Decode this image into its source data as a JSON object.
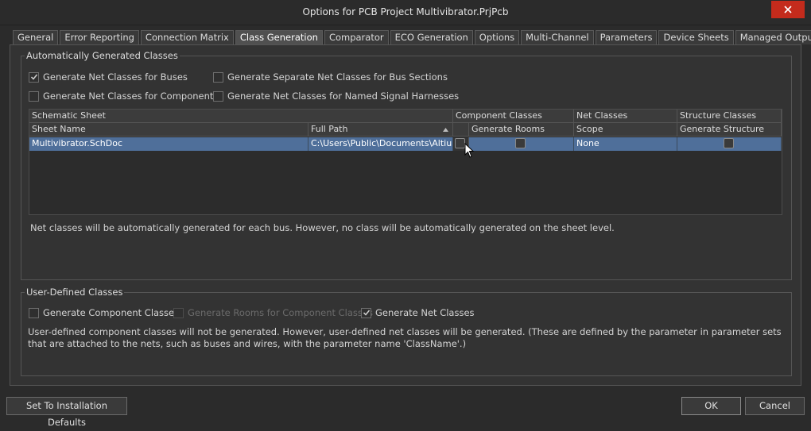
{
  "window": {
    "title": "Options for PCB Project Multivibrator.PrjPcb"
  },
  "tabs": [
    {
      "label": "General"
    },
    {
      "label": "Error Reporting"
    },
    {
      "label": "Connection Matrix"
    },
    {
      "label": "Class Generation",
      "active": true
    },
    {
      "label": "Comparator"
    },
    {
      "label": "ECO Generation"
    },
    {
      "label": "Options"
    },
    {
      "label": "Multi-Channel"
    },
    {
      "label": "Parameters"
    },
    {
      "label": "Device Sheets"
    },
    {
      "label": "Managed OutputJobs"
    }
  ],
  "auto": {
    "title": "Automatically Generated Classes",
    "buses_label": "Generate Net Classes for Buses",
    "buses_checked": true,
    "components_label": "Generate Net Classes for Components",
    "components_checked": false,
    "bus_sections_label": "Generate Separate Net Classes for Bus Sections",
    "bus_sections_checked": false,
    "harnesses_label": "Generate Net Classes for Named Signal Harnesses",
    "harnesses_checked": false,
    "grid": {
      "group_headers": {
        "schematic_sheet": "Schematic Sheet",
        "component_classes": "Component Classes",
        "net_classes": "Net Classes",
        "structure_classes": "Structure Classes"
      },
      "columns": {
        "sheet_name": "Sheet Name",
        "full_path": "Full Path",
        "generate_rooms": "Generate Rooms",
        "scope": "Scope",
        "generate_structure": "Generate Structure"
      },
      "rows": [
        {
          "sheet_name": "Multivibrator.SchDoc",
          "full_path": "C:\\Users\\Public\\Documents\\Altium\\",
          "scope": "None"
        }
      ]
    },
    "note": "Net classes will be automatically generated for each bus. However, no class will be automatically generated on the sheet level."
  },
  "user": {
    "title": "User-Defined Classes",
    "component_classes_label": "Generate Component Classes",
    "component_classes_checked": false,
    "rooms_label": "Generate Rooms for Component Classes",
    "rooms_checked": false,
    "net_classes_label": "Generate Net Classes",
    "net_classes_checked": true,
    "note": "User-defined component classes will not be generated. However, user-defined net classes will be generated. (These are defined by the parameter in parameter sets that are attached to the nets, such as buses and wires, with the parameter name 'ClassName'.)"
  },
  "buttons": {
    "defaults": "Set To Installation Defaults",
    "ok": "OK",
    "cancel": "Cancel"
  }
}
